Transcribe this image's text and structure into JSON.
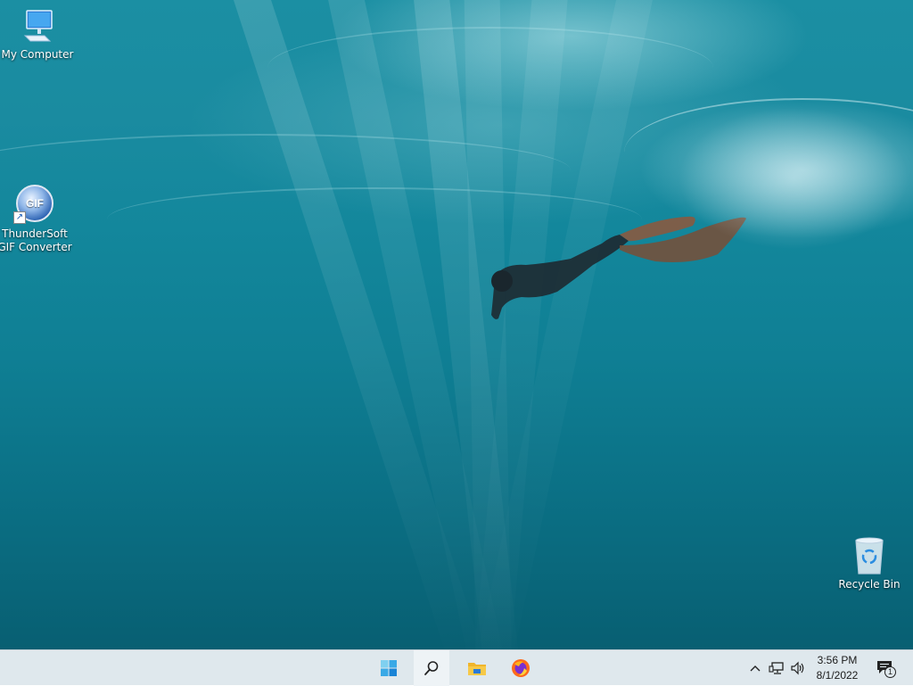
{
  "desktop": {
    "icons": [
      {
        "label": "My Computer",
        "icon": "computer-icon"
      },
      {
        "label_line1": "ThunderSoft",
        "label_line2": "GIF Converter",
        "icon": "gif-converter-icon",
        "badge": "GIF"
      },
      {
        "label": "Recycle Bin",
        "icon": "recycle-bin-icon"
      }
    ]
  },
  "taskbar": {
    "pinned": [
      {
        "name": "start",
        "icon": "windows-start-icon"
      },
      {
        "name": "search",
        "icon": "search-icon"
      },
      {
        "name": "file-explorer",
        "icon": "folder-icon"
      },
      {
        "name": "firefox",
        "icon": "firefox-icon"
      }
    ],
    "tray": {
      "icons": [
        "chevron-up-icon",
        "network-icon",
        "volume-icon"
      ],
      "time": "3:56 PM",
      "date": "8/1/2022",
      "notification_count": "1"
    }
  },
  "colors": {
    "water_top": "#1b8fa3",
    "water_bottom": "#085f72",
    "taskbar_bg": "#dfe8ed",
    "accent_blue": "#0a64c8"
  }
}
